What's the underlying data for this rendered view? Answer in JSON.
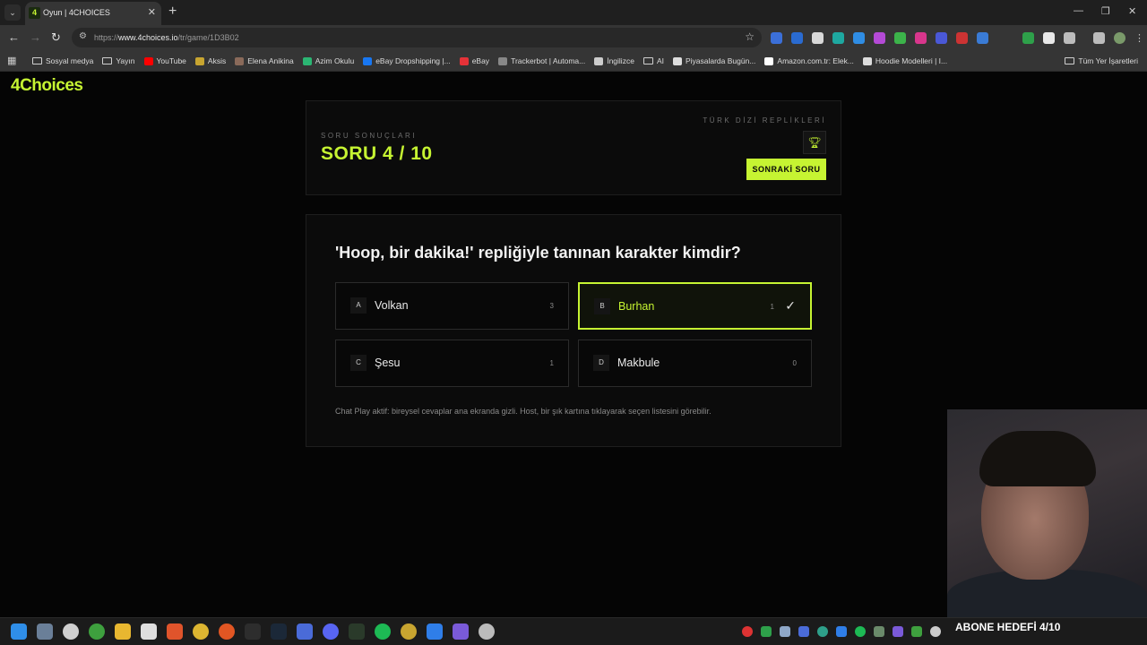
{
  "browser": {
    "tab_title": "Oyun | 4CHOICES",
    "tab_favicon_text": "4",
    "url_protocol": "https://",
    "url_host": "www.4choices.io",
    "url_path": "/tr/game/1D3B02",
    "bookmarks": [
      {
        "label": "Sosyal medya",
        "icon": "folder-icon"
      },
      {
        "label": "Yayın",
        "icon": "folder-icon"
      },
      {
        "label": "YouTube",
        "icon": "youtube-icon",
        "color": "#ff0000"
      },
      {
        "label": "Aksis",
        "icon": "aksis-icon",
        "color": "#c8a530"
      },
      {
        "label": "Elena Anikina",
        "icon": "avatar-icon",
        "color": "#8a6a5a"
      },
      {
        "label": "Azim Okulu",
        "icon": "azim-icon",
        "color": "#2bb673"
      },
      {
        "label": "eBay Dropshipping |...",
        "icon": "facebook-icon",
        "color": "#1877f2"
      },
      {
        "label": "eBay",
        "icon": "ebay-icon",
        "color": "#e53238"
      },
      {
        "label": "Trackerbot | Automa...",
        "icon": "trackerbot-icon",
        "color": "#888888"
      },
      {
        "label": "İngilizce",
        "icon": "doc-icon",
        "color": "#cccccc"
      },
      {
        "label": "AI",
        "icon": "folder-icon"
      },
      {
        "label": "Piyasalarda Bugün...",
        "icon": "tv-icon",
        "color": "#dddddd"
      },
      {
        "label": "Amazon.com.tr: Elek...",
        "icon": "amazon-icon",
        "color": "#ffffff"
      },
      {
        "label": "Hoodie Modelleri | I...",
        "icon": "hoodie-icon",
        "color": "#dddddd"
      }
    ],
    "all_bookmarks_label": "Tüm Yer İşaretleri"
  },
  "page": {
    "logo": "4Choices",
    "results_label": "SORU SONUÇLARI",
    "question_count": "SORU 4 / 10",
    "category": "TÜRK DİZİ REPLİKLERİ",
    "next_button": "SONRAKİ SORU",
    "question": "'Hoop, bir dakika!' repliğiyle tanınan karakter kimdir?",
    "options": [
      {
        "letter": "A",
        "text": "Volkan",
        "count": "3",
        "correct": false
      },
      {
        "letter": "B",
        "text": "Burhan",
        "count": "1",
        "correct": true
      },
      {
        "letter": "C",
        "text": "Şesu",
        "count": "1",
        "correct": false
      },
      {
        "letter": "D",
        "text": "Makbule",
        "count": "0",
        "correct": false
      }
    ],
    "note": "Chat Play aktif: bireysel cevaplar ana ekranda gizli. Host, bir şık kartına tıklayarak seçen listesini görebilir."
  },
  "overlay": {
    "subscriber_goal": "ABONE HEDEFİ 4/10"
  },
  "colors": {
    "accent": "#c6f432",
    "background": "#050505",
    "card": "#0b0b0b"
  }
}
